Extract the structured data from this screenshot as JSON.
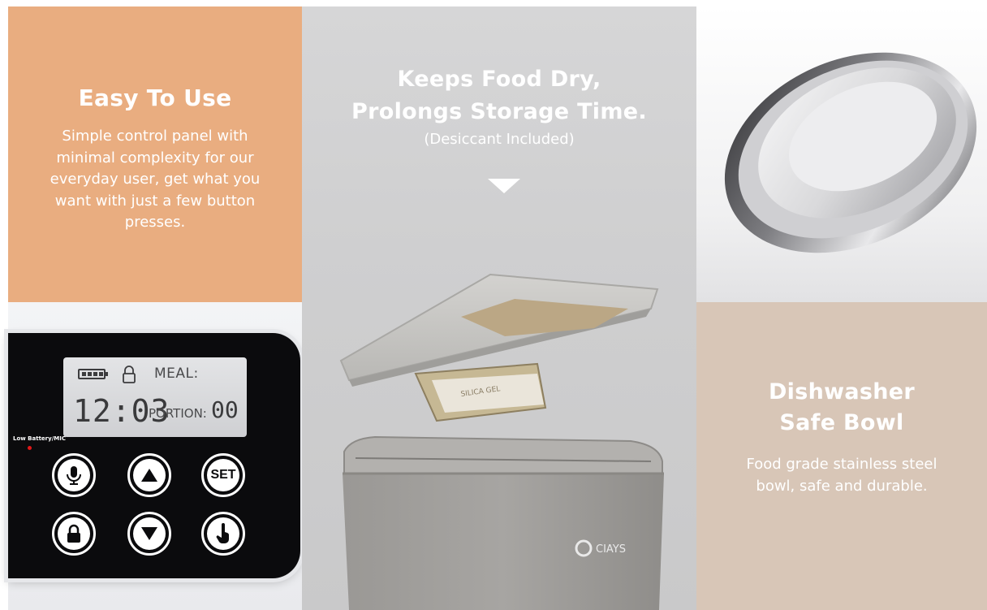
{
  "left": {
    "heading": "Easy To Use",
    "description": "Simple control panel with minimal complexity for our everyday user, get what you want with just a few button presses.",
    "panel": {
      "lcd_meal": "MEAL:",
      "lcd_time": "12:03",
      "lcd_portion_label": "PORTION:",
      "lcd_portion_value": "00",
      "low_battery_label": "Low Battery/MIC",
      "set_label": "SET",
      "buttons": [
        "microphone-icon",
        "up-arrow-icon",
        "set-button",
        "lock-icon",
        "down-arrow-icon",
        "hand-pointer-icon"
      ]
    },
    "colors": {
      "background": "#e9ad80"
    }
  },
  "middle": {
    "heading_line1": "Keeps Food Dry,",
    "heading_line2": "Prolongs Storage Time.",
    "note": "(Desiccant Included)",
    "brand": "CIAYS",
    "desiccant_text": "SILICA GEL"
  },
  "right": {
    "heading_line1": "Dishwasher",
    "heading_line2": "Safe Bowl",
    "description": "Food grade stainless steel bowl, safe and durable.",
    "colors": {
      "background": "#d8c6b7"
    }
  }
}
